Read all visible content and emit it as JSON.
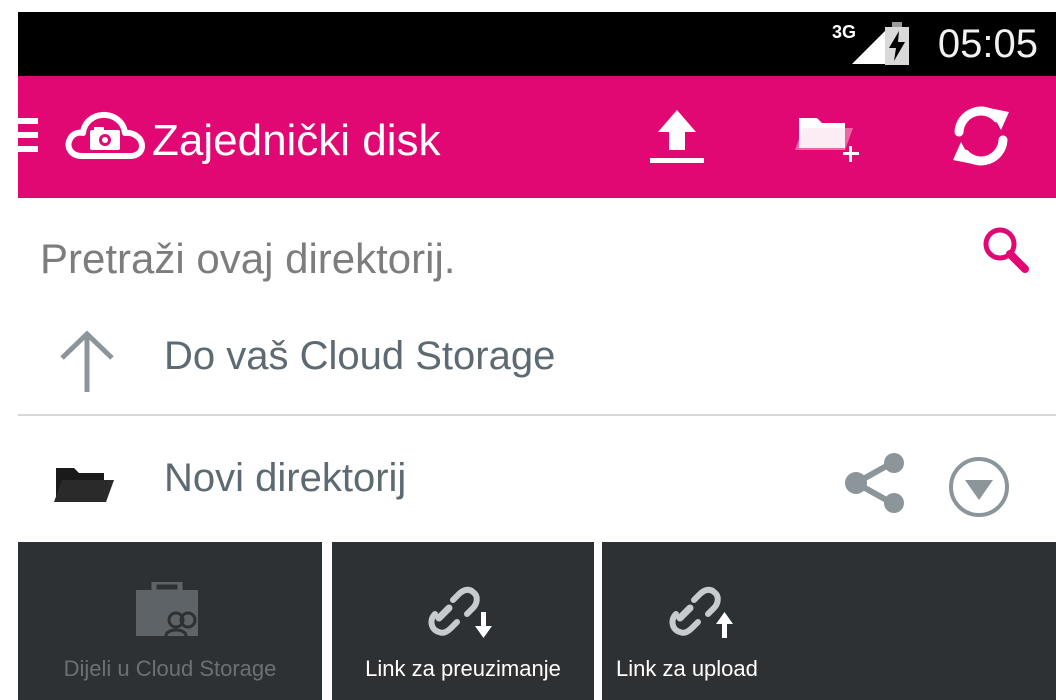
{
  "status_bar": {
    "network": "3G",
    "time": "05:05"
  },
  "app_bar": {
    "title": "Zajednički disk",
    "icons": [
      "menu-icon",
      "cloud-logo-icon",
      "upload-icon",
      "new-folder-icon",
      "refresh-icon"
    ],
    "accent": "#e20874"
  },
  "search": {
    "placeholder": "Pretraži ovaj direktorij.",
    "value": ""
  },
  "rows": {
    "up": {
      "label": "Do vaš Cloud Storage",
      "icon": "arrow-up-icon"
    },
    "folder": {
      "label": "Novi direktorij",
      "icon": "folder-icon"
    }
  },
  "actions": [
    {
      "label": "Dijeli u Cloud Storage",
      "icon": "share-cloud-icon",
      "enabled": false
    },
    {
      "label": "Link za preuzimanje",
      "icon": "link-download-icon",
      "enabled": true
    },
    {
      "label": "Link za upload",
      "icon": "link-upload-icon",
      "enabled": true
    }
  ],
  "colors": {
    "action_bar": "#2e3133",
    "text_muted": "#5d6a71"
  }
}
